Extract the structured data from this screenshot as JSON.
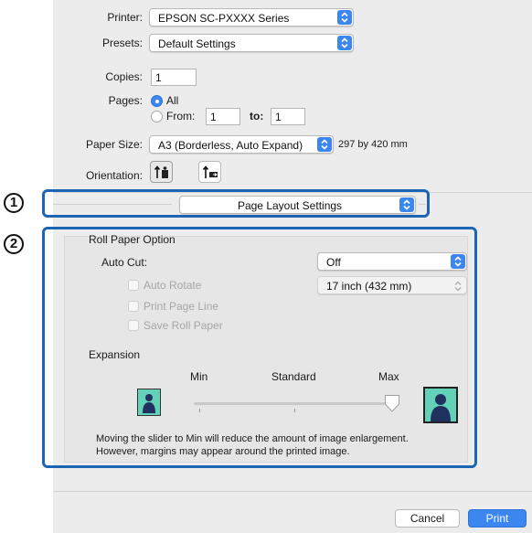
{
  "print_dialog": {
    "printer": {
      "label": "Printer:",
      "value": "EPSON SC-PXXXX Series"
    },
    "presets": {
      "label": "Presets:",
      "value": "Default Settings"
    },
    "copies": {
      "label": "Copies:",
      "value": "1"
    },
    "pages": {
      "label": "Pages:",
      "all_label": "All",
      "from_label": "From:",
      "from_value": "1",
      "to_label": "to:",
      "to_value": "1",
      "selected": "All"
    },
    "paper_size": {
      "label": "Paper Size:",
      "value": "A3 (Borderless, Auto Expand)",
      "dimensions": "297 by 420 mm"
    },
    "orientation": {
      "label": "Orientation:",
      "selected": "portrait"
    },
    "panel_select": {
      "value": "Page Layout Settings"
    },
    "roll_paper": {
      "title": "Roll Paper Option",
      "auto_cut_label": "Auto Cut:",
      "auto_cut_value": "Off",
      "auto_rotate_label": "Auto Rotate",
      "auto_rotate_value": "17 inch (432 mm)",
      "print_page_line_label": "Print Page Line",
      "save_roll_paper_label": "Save Roll Paper"
    },
    "expansion": {
      "title": "Expansion",
      "min_label": "Min",
      "standard_label": "Standard",
      "max_label": "Max",
      "slider_position": "Max",
      "description_line1": "Moving the slider to Min will reduce the amount of image enlargement.",
      "description_line2": "However, margins may appear around the printed image."
    },
    "buttons": {
      "cancel": "Cancel",
      "print": "Print"
    }
  },
  "callouts": {
    "one": "1",
    "two": "2"
  },
  "colors": {
    "accent": "#3b86ef",
    "callout": "#1e64b4",
    "thumbnail": "#63d0b8"
  }
}
